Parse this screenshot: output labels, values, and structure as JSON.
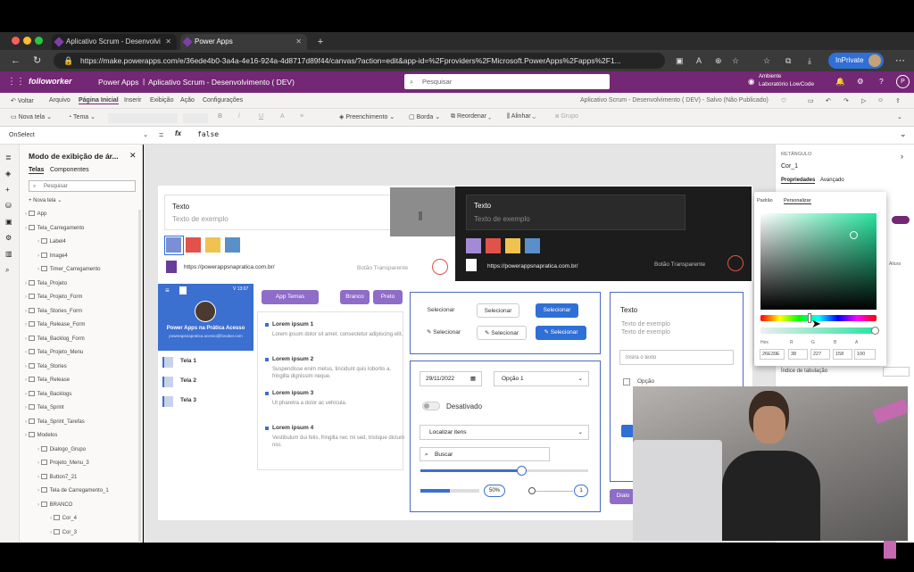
{
  "browser": {
    "tabs": [
      {
        "label": "Aplicativo Scrum - Desenvolvi"
      },
      {
        "label": "Power Apps"
      }
    ],
    "new_tab": "+",
    "url": "https://make.powerapps.com/e/36ede4b0-3a4a-4e16-924a-4d8717d89f44/canvas/?action=edit&app-id=%2Fproviders%2FMicrosoft.PowerApps%2Fapps%2F1...",
    "inprivate": "InPrivate"
  },
  "header": {
    "logo": "followorker",
    "product": "Power Apps",
    "app_title": "Aplicativo Scrum - Desenvolvimento ( DEV)",
    "search_placeholder": "Pesquisar",
    "env_label": "Ambiente",
    "env_name": "Laboratório LowCode",
    "user_initial": "P"
  },
  "menu": {
    "back": "Voltar",
    "items": [
      "Arquivo",
      "Página Inicial",
      "Inserir",
      "Exibição",
      "Ação",
      "Configurações"
    ],
    "status": "Aplicativo Scrum - Desenvolvimento ( DEV) - Salvo (Não Publicado)"
  },
  "toolbar": {
    "new_screen": "Nova tela",
    "theme": "Tema",
    "bold": "B",
    "italic": "/",
    "underline": "U",
    "fill": "Preenchimento",
    "border": "Borda",
    "reorder": "Reordenar",
    "align": "Alinhar",
    "group": "Grupo"
  },
  "formula": {
    "property": "OnSelect",
    "equals": "=",
    "fx": "fx",
    "value": "false"
  },
  "tree": {
    "title": "Modo de exibição de ár...",
    "tabs": [
      "Telas",
      "Componentes"
    ],
    "search": "Pesquisar",
    "new_screen": "Nova tela",
    "items": [
      {
        "label": "App",
        "indent": 0
      },
      {
        "label": "Tela_Carregamento",
        "indent": 0
      },
      {
        "label": "Label4",
        "indent": 1
      },
      {
        "label": "Image4",
        "indent": 1
      },
      {
        "label": "Timer_Carregamento",
        "indent": 1
      },
      {
        "label": "Tela_Projeto",
        "indent": 0
      },
      {
        "label": "Tela_Projeto_Form",
        "indent": 0
      },
      {
        "label": "Tela_Stories_Form",
        "indent": 0
      },
      {
        "label": "Tela_Release_Form",
        "indent": 0
      },
      {
        "label": "Tela_Backlog_Form",
        "indent": 0
      },
      {
        "label": "Tela_Projeto_Menu",
        "indent": 0
      },
      {
        "label": "Tela_Stories",
        "indent": 0
      },
      {
        "label": "Tela_Release",
        "indent": 0
      },
      {
        "label": "Tela_Backlogs",
        "indent": 0
      },
      {
        "label": "Tela_Sprint",
        "indent": 0
      },
      {
        "label": "Tela_Sprint_Tarefas",
        "indent": 0
      },
      {
        "label": "Modelos",
        "indent": 0
      },
      {
        "label": "Dialogo_Grupo",
        "indent": 1
      },
      {
        "label": "Projeto_Menu_3",
        "indent": 1
      },
      {
        "label": "Button7_21",
        "indent": 1
      },
      {
        "label": "Tela de Carregamento_1",
        "indent": 1
      },
      {
        "label": "BRANCO",
        "indent": 1
      },
      {
        "label": "Cor_4",
        "indent": 2
      },
      {
        "label": "Cor_3",
        "indent": 2
      }
    ]
  },
  "canvas": {
    "light_card": {
      "title": "Texto",
      "subtitle": "Texto de exemplo"
    },
    "dark_card": {
      "title": "Texto",
      "subtitle": "Texto de exemplo"
    },
    "swatches": [
      "#7b8fd6",
      "#e0524a",
      "#f0c24f",
      "#5a8fc9"
    ],
    "dark_swatches": [
      "#a48ad4",
      "#e0524a",
      "#f0c24f",
      "#5a8fc9"
    ],
    "link": "https://powerappsnapratica.com.br/",
    "transparent_button": "Botão Transparente",
    "phone": {
      "time": "V 13:07",
      "name": "Power Apps na Prática Acesso",
      "email": "powerapsnapratica.acesso@fonoker.com",
      "screens": [
        "Tela 1",
        "Tela 2",
        "Tela 3"
      ]
    },
    "buttons": {
      "app_temas": "App Temas",
      "branco": "Branco",
      "preto": "Preto"
    },
    "list": [
      {
        "title": "Lorem ipsum 1",
        "body": "Lorem ipsum dolor sit amet, consectetur adipiscing elit."
      },
      {
        "title": "Lorem ipsum 2",
        "body": "Suspendisse enim metus, tincidunt quis lobortis a, fringilla dignissim neque."
      },
      {
        "title": "Lorem ipsum 3",
        "body": "Ut pharetra a dolor ac vehicula."
      },
      {
        "title": "Lorem ipsum 4",
        "body": "Vestibulum dui felis, fringilla nec mi sed, tristique dictum nisi."
      }
    ],
    "select_buttons": [
      "Selecionar",
      "Selecionar",
      "Selecionar",
      "Selecionar",
      "Selecionar",
      "Selecionar"
    ],
    "form": {
      "date": "29/11/2022",
      "option": "Opção 1",
      "toggle_label": "Desativado",
      "find": "Localizar itens",
      "search": "Buscar",
      "percent": "50%",
      "counter": "1",
      "slider_value": 0.6,
      "progress_value": 0.5
    },
    "text_card": {
      "title": "Texto",
      "line1": "Texto de exemplo",
      "line2": "Texto de exemplo",
      "input": "Insira o texto",
      "option": "Opção"
    },
    "dialog_btn": "Dialo"
  },
  "props": {
    "type": "RETÂNGULO",
    "name": "Cor_1",
    "tabs": [
      "Propriedades",
      "Avançado"
    ],
    "tab_order": "Índice de tabulação",
    "picker_tabs": [
      "Padrão",
      "Personalizar"
    ],
    "labels": [
      "Hex",
      "R",
      "G",
      "B",
      "A"
    ],
    "values": [
      "26E39E",
      "38",
      "227",
      "158",
      "100"
    ],
    "right_snip": "Altura"
  },
  "colors": {
    "brand": "#742774",
    "accent": "#2f6fd6",
    "button_purple": "#8e6cc7",
    "select_blue": "#2f6fd6"
  }
}
